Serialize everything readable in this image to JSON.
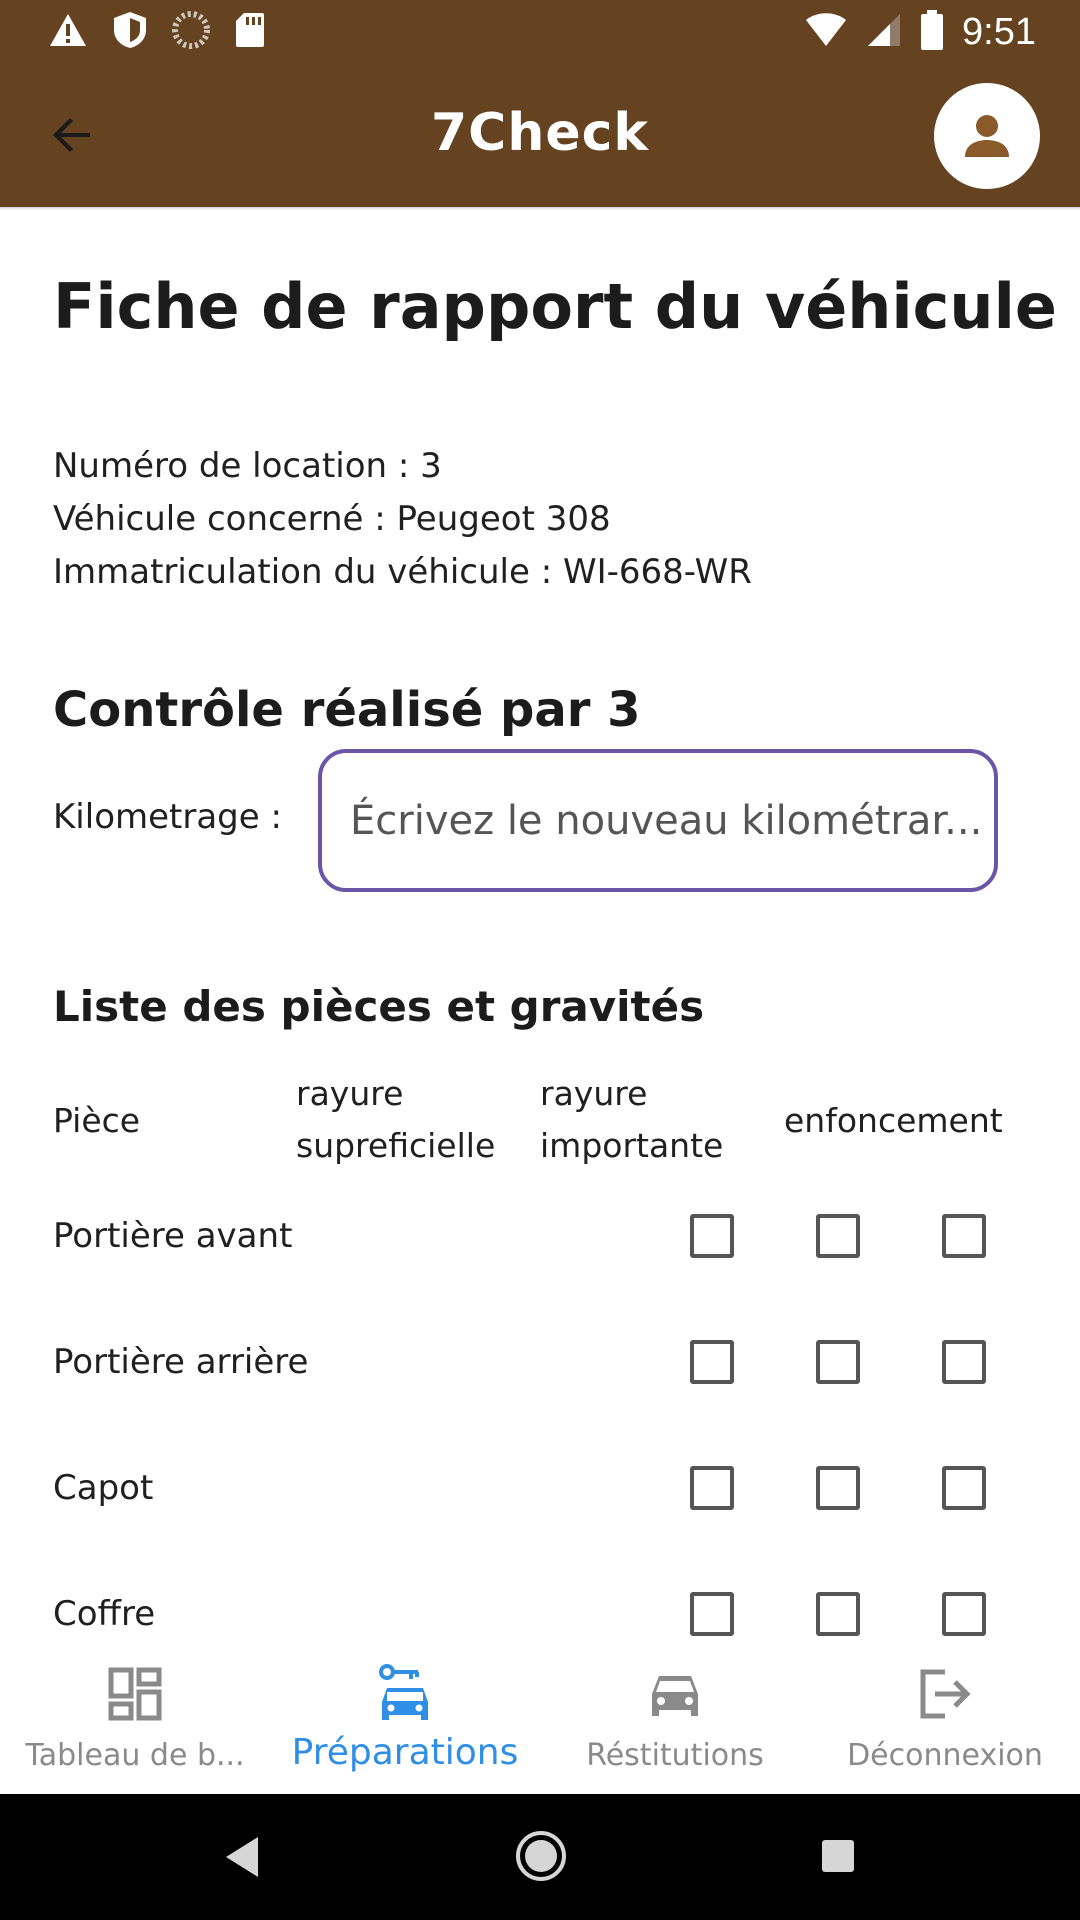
{
  "status_bar": {
    "time": "9:51",
    "left_icons": [
      "warning-icon",
      "shield-icon",
      "loading-icon",
      "sd-card-icon"
    ],
    "right_icons": [
      "wifi-icon",
      "signal-icon",
      "battery-icon"
    ]
  },
  "app_bar": {
    "title": "7Check",
    "back_icon": "arrow-back-icon",
    "account_icon": "account-icon",
    "color": "#654321"
  },
  "report": {
    "title": "Fiche de rapport du véhicule",
    "rental_number": "Numéro de location : 3",
    "vehicle": "Véhicule concerné : Peugeot 308",
    "plate": "Immatriculation du véhicule : WI-668-WR"
  },
  "control": {
    "title": "Contrôle réalisé par 3",
    "mileage_label": "Kilometrage :",
    "mileage_placeholder": "Écrivez le nouveau kilométrar...",
    "mileage_value": "",
    "input_border_color": "#6a55a6"
  },
  "parts": {
    "title": "Liste des pièces et gravités",
    "headers": {
      "part": "Pièce",
      "scratch_superficial_line1": "rayure",
      "scratch_superficial_line2": "supreficielle",
      "scratch_major_line1": "rayure",
      "scratch_major_line2": "importante",
      "dent": "enfoncement"
    },
    "rows": [
      {
        "label": "Portière avant",
        "checks": [
          false,
          false,
          false
        ]
      },
      {
        "label": "Portière arrière",
        "checks": [
          false,
          false,
          false
        ]
      },
      {
        "label": "Capot",
        "checks": [
          false,
          false,
          false
        ]
      },
      {
        "label": "Coffre",
        "checks": [
          false,
          false,
          false
        ]
      }
    ]
  },
  "bottom_nav": {
    "active_color": "#2f8fe6",
    "items": [
      {
        "label": "Tableau de b...",
        "icon": "dashboard-icon",
        "active": false
      },
      {
        "label": "Préparations",
        "icon": "car-key-icon",
        "active": true
      },
      {
        "label": "Réstitutions",
        "icon": "car-icon",
        "active": false
      },
      {
        "label": "Déconnexion",
        "icon": "logout-icon",
        "active": false
      }
    ]
  },
  "system_nav": {
    "icons": [
      "back-triangle-icon",
      "home-circle-icon",
      "recents-square-icon"
    ]
  }
}
